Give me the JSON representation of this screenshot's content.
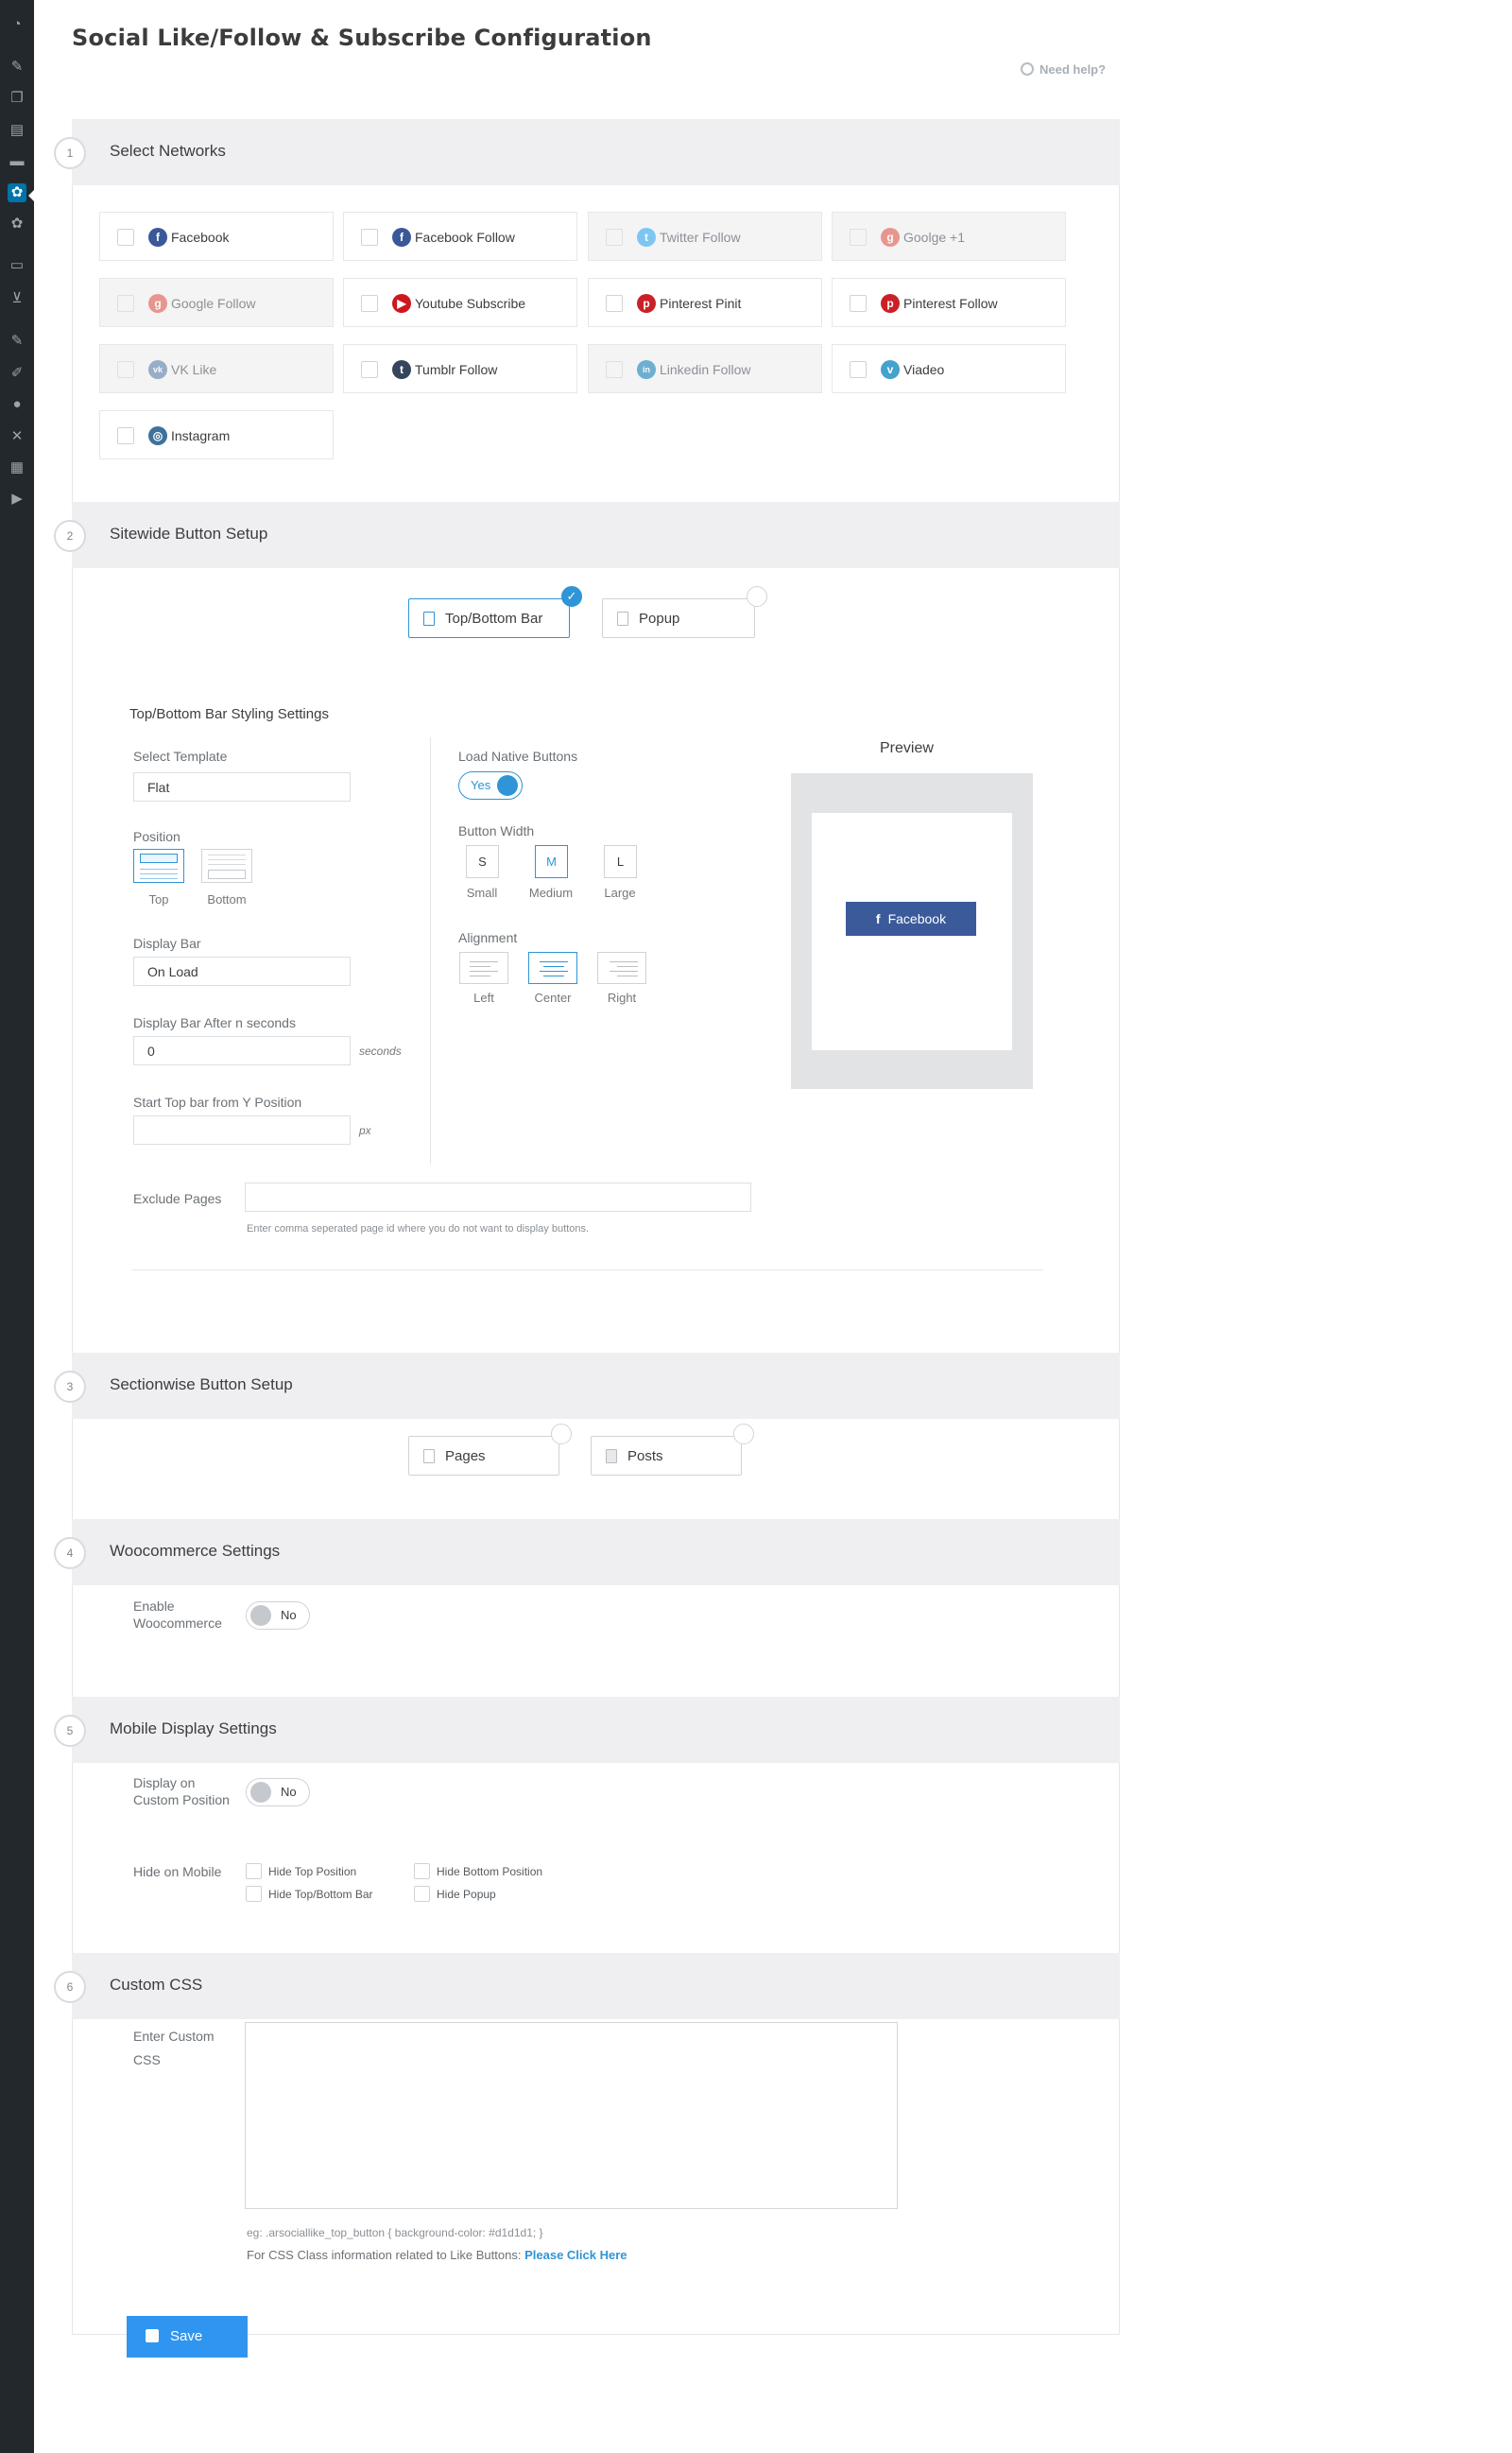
{
  "page": {
    "title": "Social Like/Follow & Subscribe Configuration",
    "need_help": "Need help?"
  },
  "sections": [
    {
      "num": "1",
      "title": "Select Networks"
    },
    {
      "num": "2",
      "title": "Sitewide Button Setup"
    },
    {
      "num": "3",
      "title": "Sectionwise Button Setup"
    },
    {
      "num": "4",
      "title": "Woocommerce Settings"
    },
    {
      "num": "5",
      "title": "Mobile Display Settings"
    },
    {
      "num": "6",
      "title": "Custom CSS"
    }
  ],
  "networks": [
    {
      "label": "Facebook",
      "icon": "facebook-icon",
      "color": "#3b5998",
      "disabled": false
    },
    {
      "label": "Facebook Follow",
      "icon": "facebook-icon",
      "color": "#3b5998",
      "disabled": false
    },
    {
      "label": "Twitter Follow",
      "icon": "twitter-icon",
      "color": "#1da1f2",
      "disabled": true
    },
    {
      "label": "Goolge +1",
      "icon": "google-plus-icon",
      "color": "#dd4b39",
      "disabled": true
    },
    {
      "label": "Google Follow",
      "icon": "google-plus-icon",
      "color": "#dd4b39",
      "disabled": true
    },
    {
      "label": "Youtube Subscribe",
      "icon": "youtube-icon",
      "color": "#cc181e",
      "disabled": false
    },
    {
      "label": "Pinterest Pinit",
      "icon": "pinterest-icon",
      "color": "#cb2027",
      "disabled": false
    },
    {
      "label": "Pinterest Follow",
      "icon": "pinterest-icon",
      "color": "#cb2027",
      "disabled": false
    },
    {
      "label": "VK Like",
      "icon": "vk-icon",
      "color": "#4c75a3",
      "disabled": true
    },
    {
      "label": "Tumblr Follow",
      "icon": "tumblr-icon",
      "color": "#35465c",
      "disabled": false
    },
    {
      "label": "Linkedin Follow",
      "icon": "linkedin-icon",
      "color": "#0077b5",
      "disabled": true
    },
    {
      "label": "Viadeo",
      "icon": "viadeo-icon",
      "color": "#45a2cc",
      "disabled": false
    },
    {
      "label": "Instagram",
      "icon": "instagram-icon",
      "color": "#3f729b",
      "disabled": false
    }
  ],
  "sitewide": {
    "options": [
      {
        "label": "Top/Bottom Bar",
        "selected": true
      },
      {
        "label": "Popup",
        "selected": false
      }
    ],
    "styling_title": "Top/Bottom Bar Styling Settings",
    "select_template_label": "Select Template",
    "select_template_value": "Flat",
    "position_label": "Position",
    "position_top": "Top",
    "position_bottom": "Bottom",
    "display_bar_label": "Display Bar",
    "display_bar_value": "On Load",
    "display_after_label": "Display Bar After n seconds",
    "display_after_value": "0",
    "display_after_unit": "seconds",
    "start_top_label": "Start Top bar from Y Position",
    "start_top_value": "",
    "start_top_unit": "px",
    "load_native_label": "Load Native Buttons",
    "load_native_value": "Yes",
    "button_width_label": "Button Width",
    "sizes": [
      {
        "key": "S",
        "caption": "Small",
        "selected": false
      },
      {
        "key": "M",
        "caption": "Medium",
        "selected": true
      },
      {
        "key": "L",
        "caption": "Large",
        "selected": false
      }
    ],
    "alignment_label": "Alignment",
    "alignments": [
      {
        "caption": "Left",
        "selected": false
      },
      {
        "caption": "Center",
        "selected": true
      },
      {
        "caption": "Right",
        "selected": false
      }
    ],
    "preview_title": "Preview",
    "preview_button": "Facebook",
    "exclude_label": "Exclude Pages",
    "exclude_value": "",
    "exclude_hint": "Enter comma seperated page id where you do not want to display buttons."
  },
  "sectionwise": {
    "options": [
      {
        "label": "Pages",
        "selected": false
      },
      {
        "label": "Posts",
        "selected": false
      }
    ]
  },
  "woocommerce": {
    "enable_label_line1": "Enable",
    "enable_label_line2": "Woocommerce",
    "toggle_value": "No"
  },
  "mobile": {
    "display_label_line1": "Display on",
    "display_label_line2": "Custom Position",
    "toggle_value": "No",
    "hide_label": "Hide on Mobile",
    "hide_options": [
      "Hide Top Position",
      "Hide Bottom Position",
      "Hide Top/Bottom Bar",
      "Hide Popup"
    ]
  },
  "custom_css": {
    "label_line1": "Enter Custom",
    "label_line2": "CSS",
    "value": "",
    "example": "eg: .arsociallike_top_button { background-color: #d1d1d1; }",
    "info_text": "For CSS Class information related to Like Buttons:",
    "info_link": "Please Click Here"
  },
  "save_label": "Save",
  "colors": {
    "accent": "#2f95d6",
    "save": "#2f95f0",
    "facebook": "#3b5a9a"
  }
}
